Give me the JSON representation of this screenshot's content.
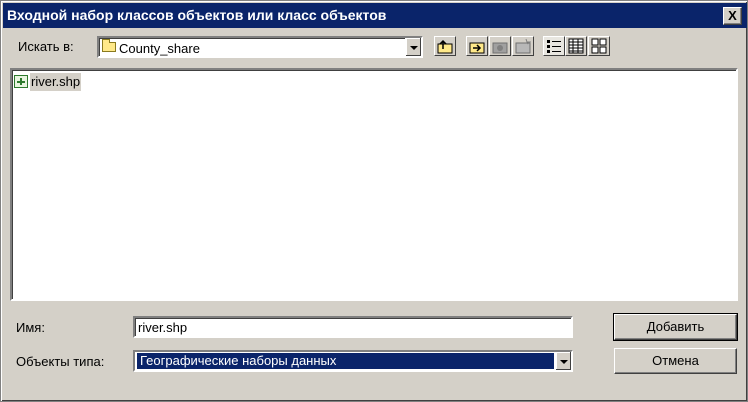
{
  "window": {
    "title": "Входной набор классов объектов или класс объектов",
    "close_label": "X"
  },
  "location": {
    "label": "Искать в:",
    "value": "County_share"
  },
  "toolbar": {
    "buttons": [
      "up-folder",
      "connect-folder",
      "disconnect-folder",
      "new-folder",
      "list-view",
      "details-view",
      "thumbnails-view"
    ]
  },
  "files": [
    {
      "name": "river.shp",
      "icon": "shapefile-icon"
    }
  ],
  "name_field": {
    "label": "Имя:",
    "value": "river.shp"
  },
  "type_field": {
    "label": "Объекты типа:",
    "value": "Географические наборы данных"
  },
  "buttons": {
    "add": "Добавить",
    "cancel": "Отмена"
  }
}
